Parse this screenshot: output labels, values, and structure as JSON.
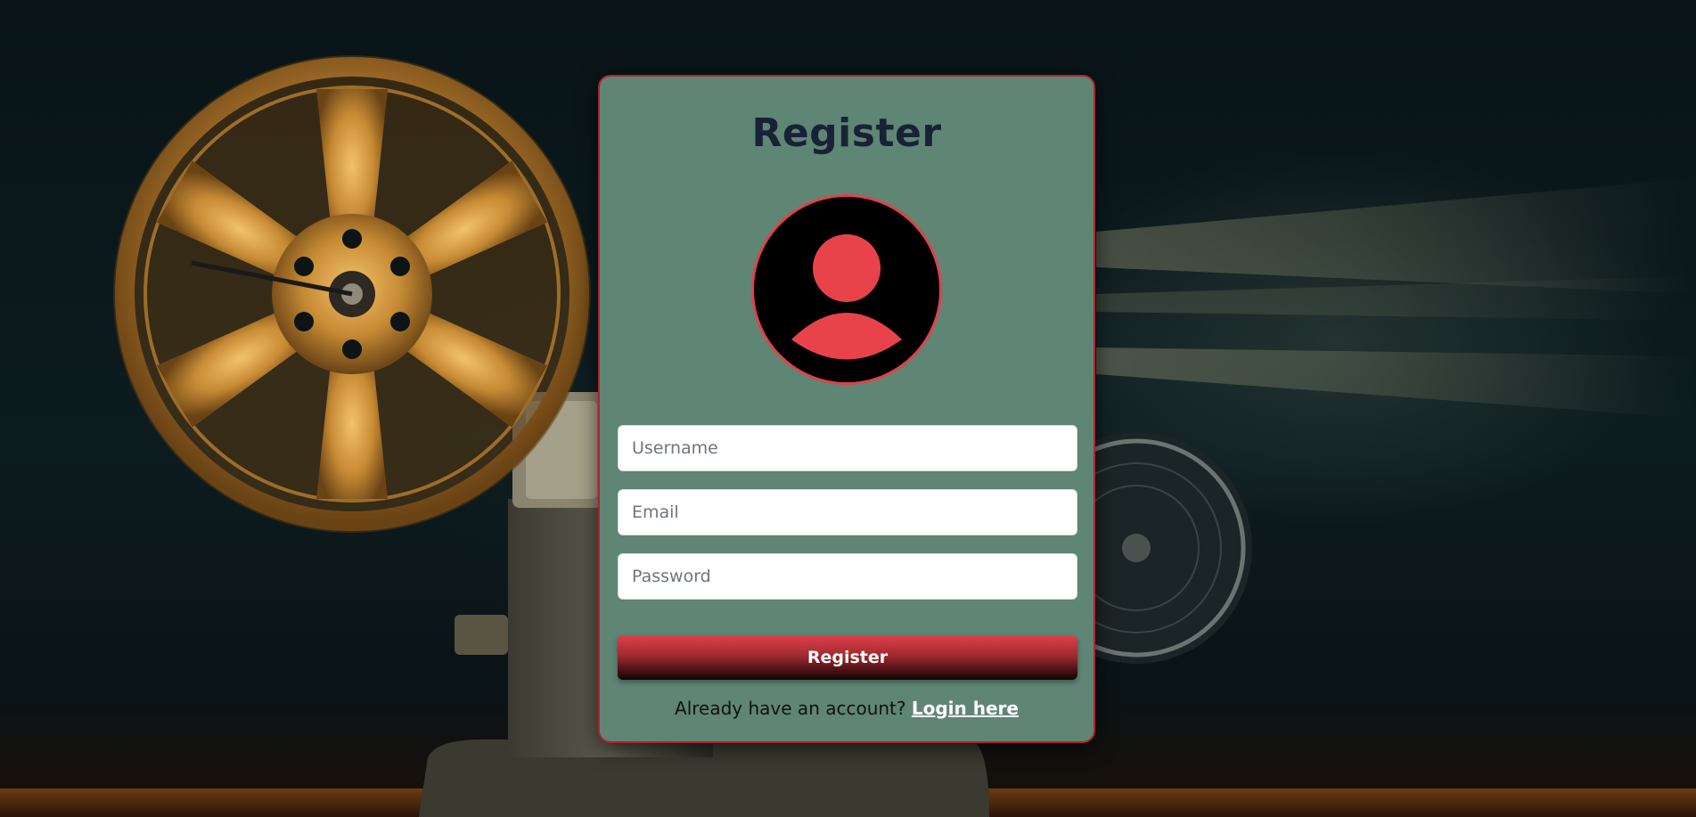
{
  "form": {
    "title": "Register",
    "avatar_icon": "user-avatar-icon",
    "username_placeholder": "Username",
    "email_placeholder": "Email",
    "password_placeholder": "Password",
    "submit_label": "Register",
    "footer_text": "Already have an account?",
    "login_link_label": "Login here"
  },
  "colors": {
    "card_background": "#5f8575",
    "card_border": "#b3232f",
    "title_color": "#182235",
    "avatar_accent": "#e0424a",
    "button_gradient_top": "#e0414a",
    "button_gradient_bottom": "#100404",
    "link_color": "#ffffff"
  }
}
